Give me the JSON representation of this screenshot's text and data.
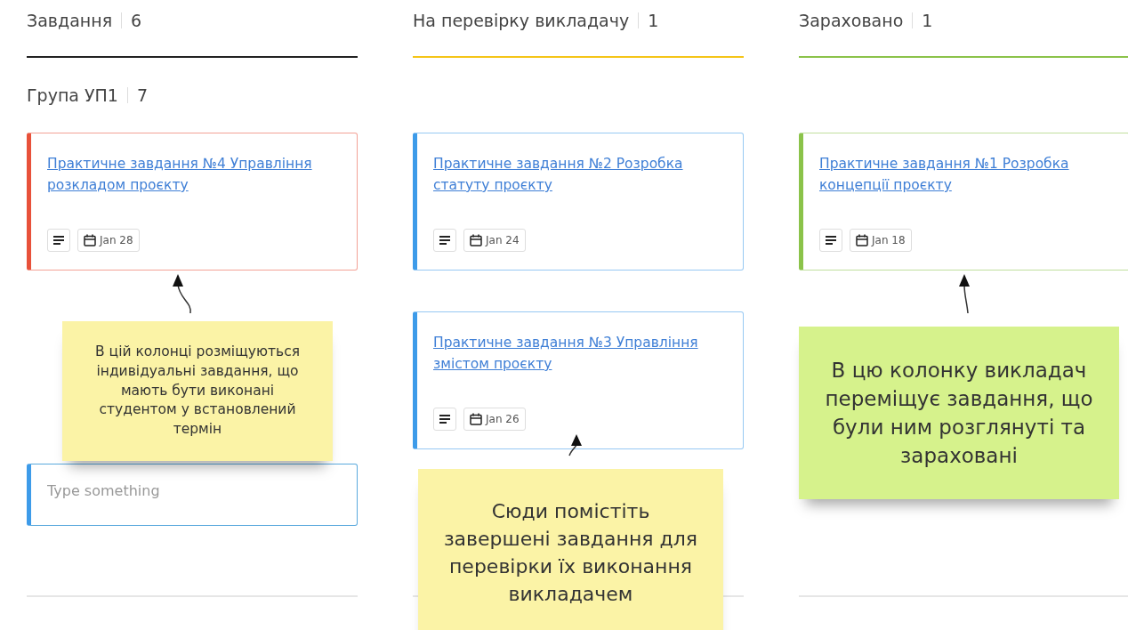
{
  "columns": [
    {
      "title": "Завдання",
      "count": "6",
      "color": "#222222",
      "group": {
        "title": "Група УП1",
        "count": "7"
      },
      "cards": [
        {
          "title": "Практичне завдання №4 Управління розкладом проєкту",
          "date": "Jan 28",
          "color": "#e8513a"
        }
      ],
      "input": {
        "placeholder": "Type something"
      }
    },
    {
      "title": "На перевірку викладачу",
      "count": "1",
      "color": "#f5c518",
      "cards": [
        {
          "title": "Практичне завдання №2 Розробка статуту проєкту",
          "date": "Jan 24",
          "color": "#3d9be9"
        },
        {
          "title": "Практичне завдання №3 Управління змістом проєкту",
          "date": "Jan 26",
          "color": "#3d9be9"
        }
      ]
    },
    {
      "title": "Зараховано",
      "count": "1",
      "color": "#8bc34a",
      "cards": [
        {
          "title": "Практичне завдання №1 Розробка концепції проєкту",
          "date": "Jan 18",
          "color": "#8bc34a"
        }
      ]
    }
  ],
  "notes": [
    {
      "text": "В цій колонці розміщуються індивідуальні завдання, що мають бути виконані студентом у встановлений термін",
      "color": "#fbf3a6"
    },
    {
      "text": "Сюди помістіть завершені завдання для перевірки їх виконання викладачем",
      "color": "#fbf3a6"
    },
    {
      "text": "В цю колонку викладач переміщує завдання, що були ним розглянуті та зараховані",
      "color": "#d6f28c"
    }
  ]
}
